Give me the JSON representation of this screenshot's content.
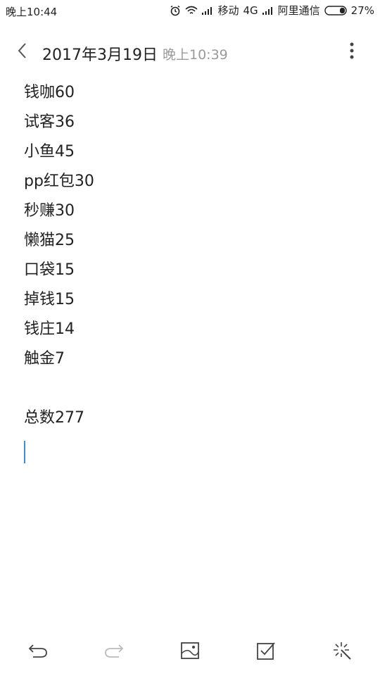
{
  "status_bar": {
    "time": "晚上10:44",
    "carrier1": "移动",
    "network": "4G",
    "carrier2": "阿里通信",
    "battery": "27%"
  },
  "header": {
    "date": "2017年3月19日",
    "time": "晚上10:39"
  },
  "note": {
    "lines": [
      "钱咖60",
      "试客36",
      "小鱼45",
      "pp红包30",
      "秒赚30",
      "懒猫25",
      "口袋15",
      "掉钱15",
      "钱庄14",
      "触金7"
    ],
    "total": "总数277"
  },
  "colors": {
    "accent": "#3a8fd8",
    "icon": "#444444",
    "disabled_icon": "#bbbbbb"
  },
  "icons": {
    "back": "back-icon",
    "more": "more-vertical-icon",
    "undo": "undo-icon",
    "redo": "redo-icon",
    "image": "image-icon",
    "checklist": "checkbox-icon",
    "magic": "magic-icon"
  }
}
